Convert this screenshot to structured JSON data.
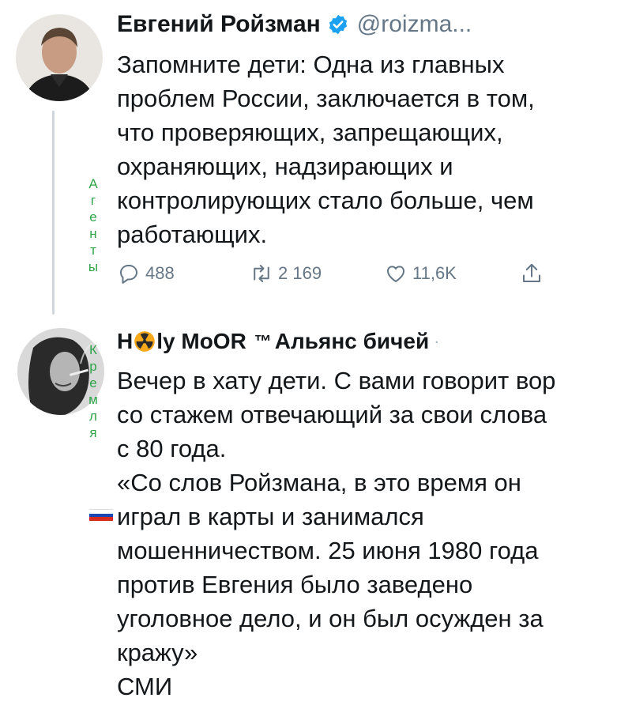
{
  "tweet1": {
    "author_name": "Евгений Ройзман",
    "handle": "@roizma...",
    "text": "Запомните дети: Одна из главных\nпроблем России, заключается в том,\nчто проверяющих, запрещающих,\nохраняющих, надзирающих и\nконтролирующих стало больше, чем\nработающих.",
    "replies": "488",
    "retweets": "2 169",
    "likes": "11,6K"
  },
  "tweet2": {
    "name_prefix": "H",
    "name_suffix": "ly MoOR",
    "tm": "™",
    "name_rest": "Альянс бичей",
    "dot": "·",
    "text": "Вечер в хату дети. С вами говорит  вор\nсо стажем отвечающий за  свои слова\nс 80 года.\n«Со слов Ройзмана, в это время он\nиграл в карты и занимался\nмошенничеством. 25 июня 1980 года\nпротив Евгения было заведено\nуголовное дело, и он был осужден за\nкражу»\nСМИ"
  },
  "overlay": {
    "agents_letters": [
      "А",
      "г",
      "е",
      "н",
      "т",
      "ы"
    ],
    "kremlin_letters": [
      "К",
      "р",
      "е",
      "м",
      "л",
      "я"
    ]
  },
  "colors": {
    "text": "#14171a",
    "secondary": "#657786",
    "verified": "#1da1f2",
    "overlay_green": "#2fa34a"
  },
  "icons": [
    "verified-badge-icon",
    "reply-icon",
    "retweet-icon",
    "like-icon",
    "share-icon",
    "radiation-emoji-icon",
    "russian-flag-icon"
  ]
}
